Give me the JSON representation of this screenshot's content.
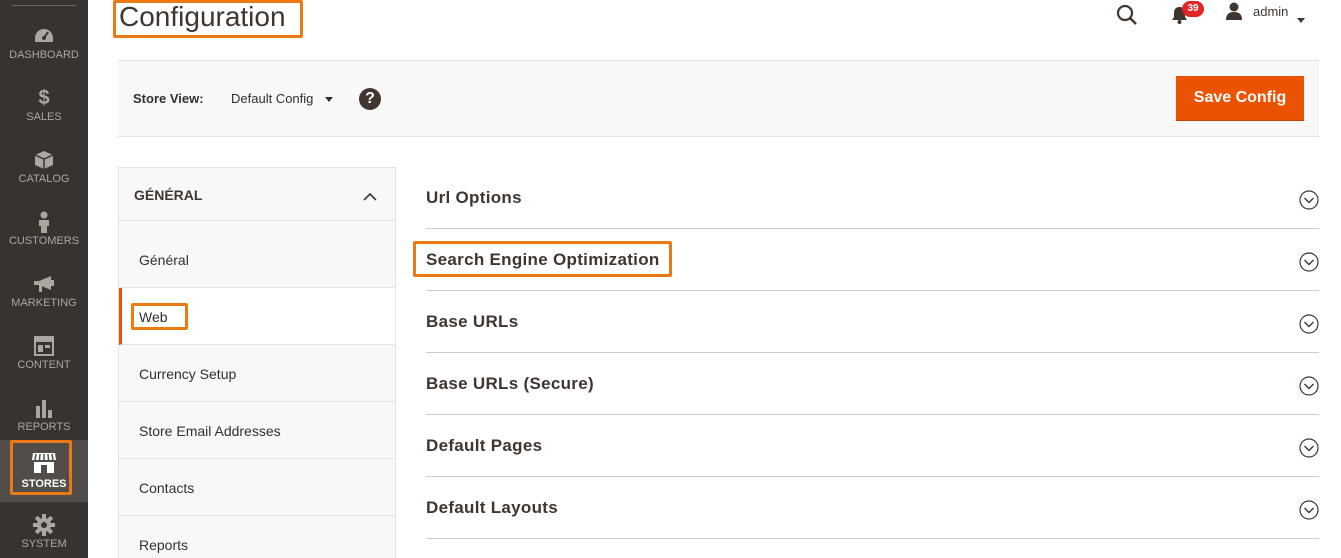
{
  "admin_menu": {
    "items": [
      {
        "label": "DASHBOARD",
        "icon": "dashboard-icon"
      },
      {
        "label": "SALES",
        "icon": "dollar-icon"
      },
      {
        "label": "CATALOG",
        "icon": "box-icon"
      },
      {
        "label": "CUSTOMERS",
        "icon": "person-icon"
      },
      {
        "label": "MARKETING",
        "icon": "megaphone-icon"
      },
      {
        "label": "CONTENT",
        "icon": "layout-icon"
      },
      {
        "label": "REPORTS",
        "icon": "bar-chart-icon"
      },
      {
        "label": "STORES",
        "icon": "storefront-icon",
        "active": true
      },
      {
        "label": "SYSTEM",
        "icon": "gear-icon"
      }
    ]
  },
  "header": {
    "title": "Configuration",
    "notifications_count": "39",
    "user_name": "admin"
  },
  "store_bar": {
    "label": "Store View:",
    "selected": "Default Config",
    "help": "?",
    "save_button": "Save Config"
  },
  "config_tabs": {
    "group_title": "GÉNÉRAL",
    "items": [
      {
        "label": "Général"
      },
      {
        "label": "Web",
        "active": true
      },
      {
        "label": "Currency Setup"
      },
      {
        "label": "Store Email Addresses"
      },
      {
        "label": "Contacts"
      },
      {
        "label": "Reports"
      }
    ]
  },
  "sections": [
    {
      "title": "Url Options"
    },
    {
      "title": "Search Engine Optimization"
    },
    {
      "title": "Base URLs"
    },
    {
      "title": "Base URLs (Secure)"
    },
    {
      "title": "Default Pages"
    },
    {
      "title": "Default Layouts"
    }
  ],
  "colors": {
    "menu_bg": "#373330",
    "accent": "#eb5202",
    "highlight": "#eb7a13",
    "badge": "#e22626"
  }
}
